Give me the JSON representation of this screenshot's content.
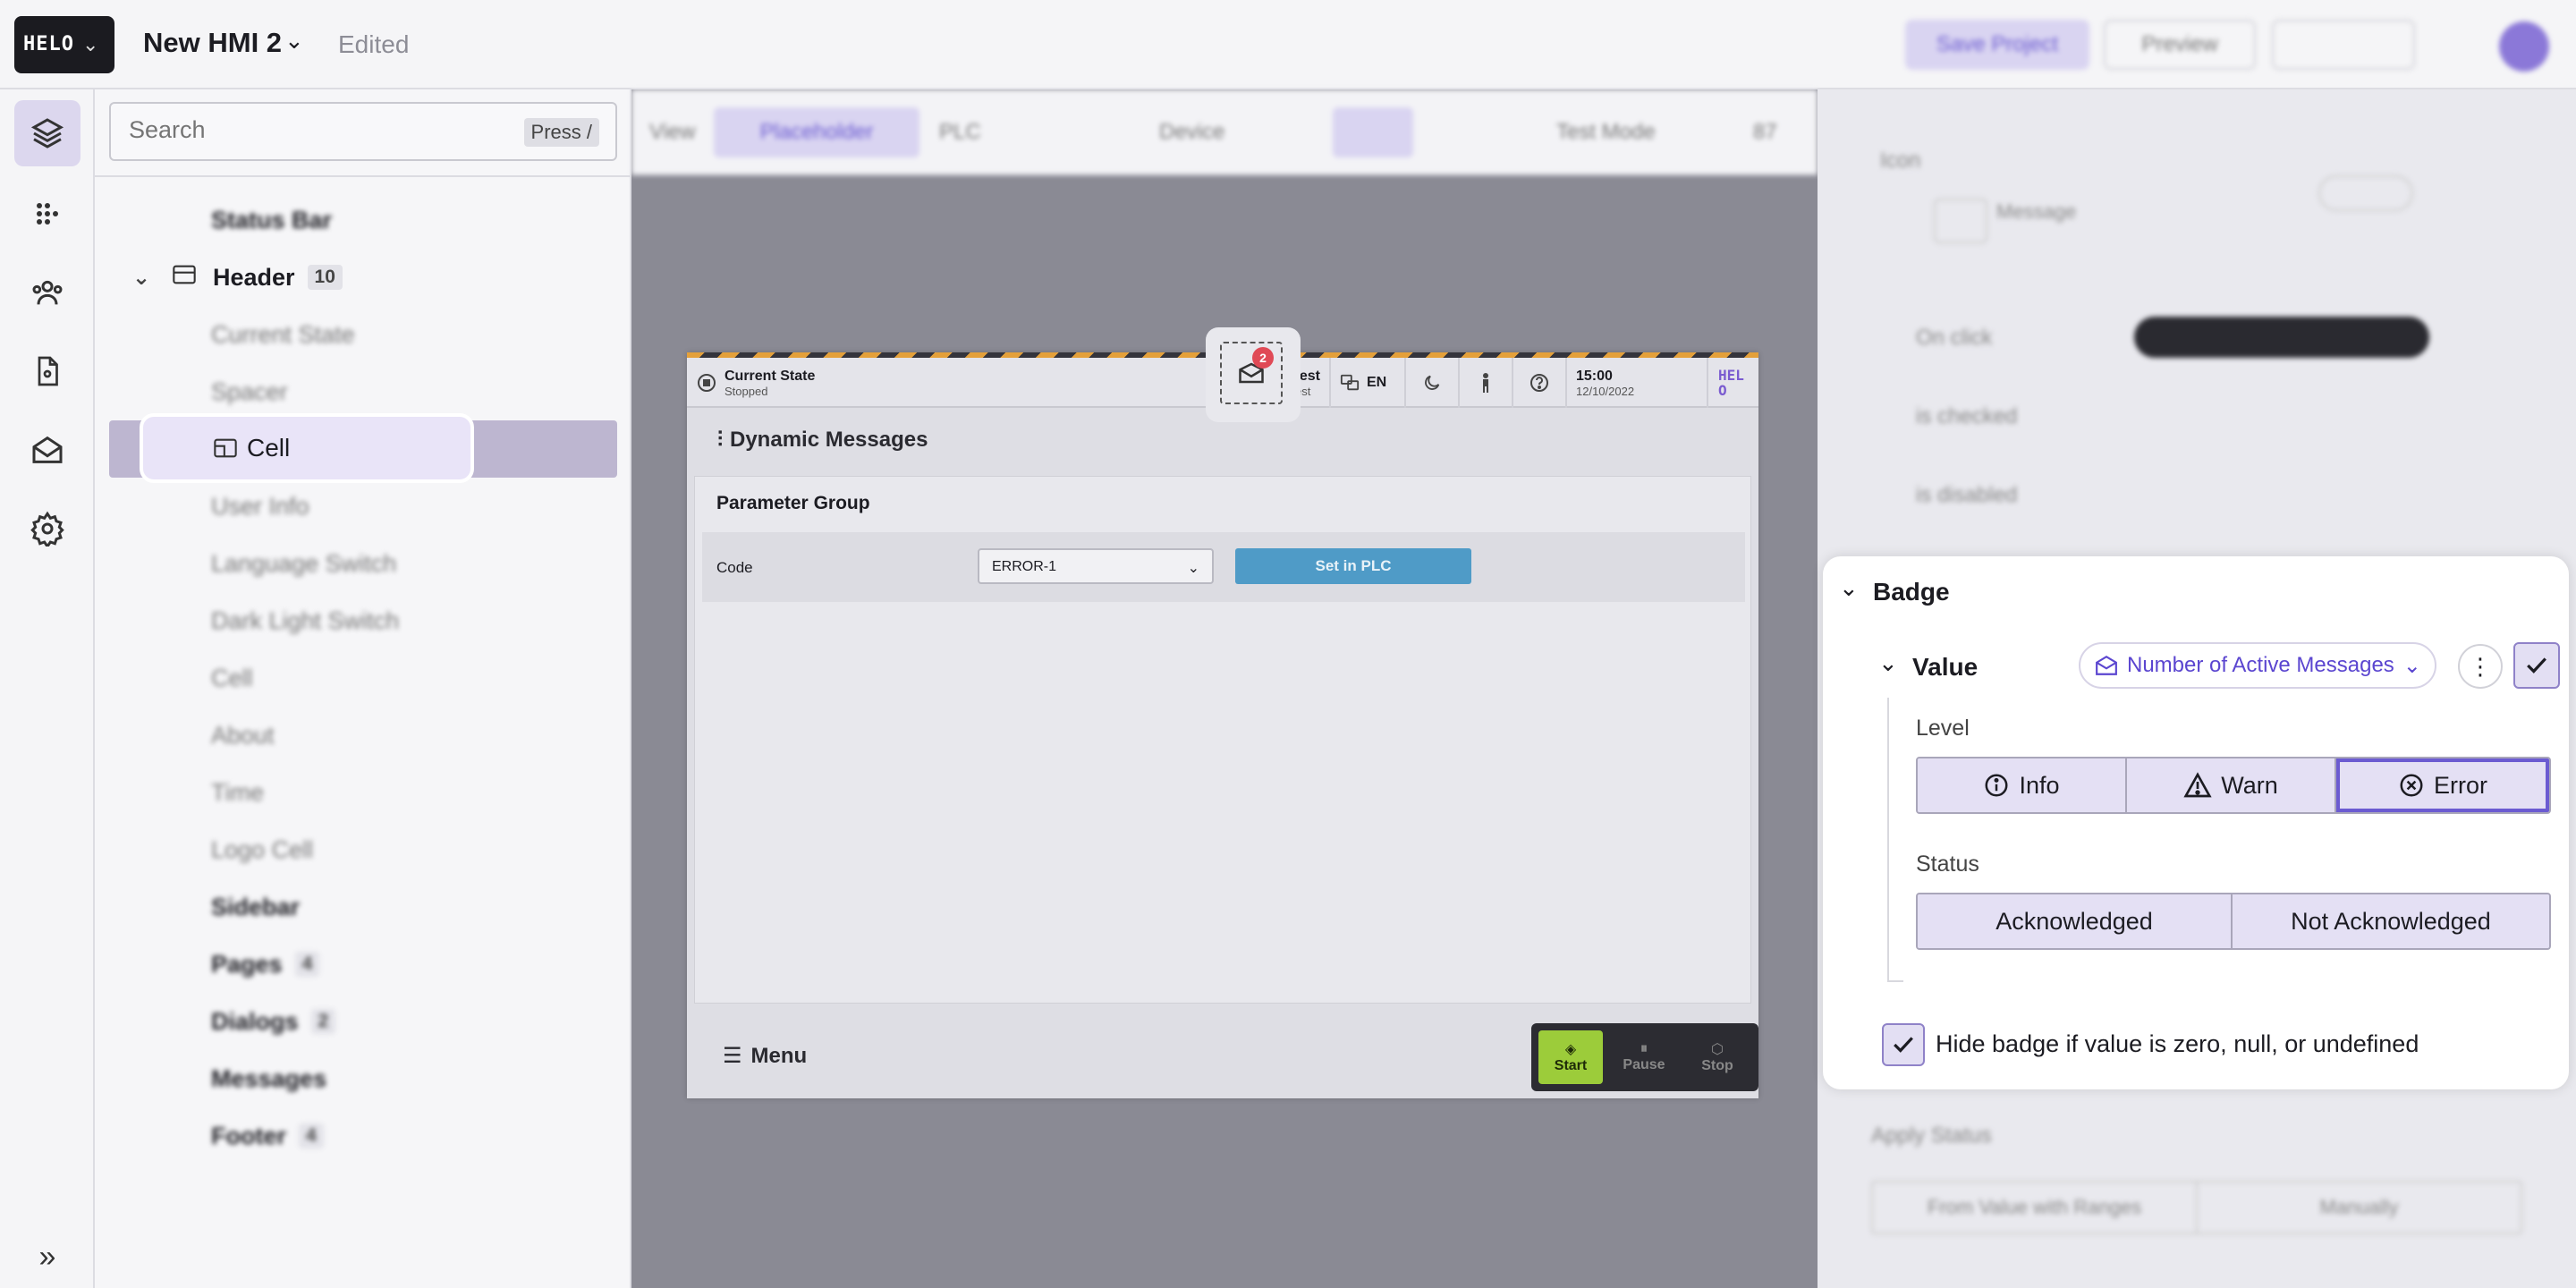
{
  "app": {
    "logo_text": "HELO",
    "project_title": "New HMI 2",
    "status": "Edited"
  },
  "topbar": {
    "save_label": "Save Project",
    "preview_label": "Preview"
  },
  "layers": {
    "search_placeholder": "Search",
    "search_hint": "Press /",
    "items": [
      {
        "label": "Status Bar"
      },
      {
        "label": "Header",
        "count": "10"
      },
      {
        "label": "Current State"
      },
      {
        "label": "Spacer"
      },
      {
        "label": "Cell"
      },
      {
        "label": "User Info"
      },
      {
        "label": "Language Switch"
      },
      {
        "label": "Dark Light Switch"
      },
      {
        "label": "Cell"
      },
      {
        "label": "About"
      },
      {
        "label": "Time"
      },
      {
        "label": "Logo Cell"
      },
      {
        "label": "Sidebar"
      },
      {
        "label": "Pages",
        "count": "4"
      },
      {
        "label": "Dialogs",
        "count": "2"
      },
      {
        "label": "Messages"
      },
      {
        "label": "Footer",
        "count": "4"
      }
    ]
  },
  "canvas_toolbar": {
    "view_label": "View",
    "placeholder_label": "Placeholder",
    "plc_label": "PLC",
    "device_label": "Device",
    "test_mode_label": "Test Mode",
    "zoom_label": "87"
  },
  "hmi": {
    "current_state_label": "Current State",
    "current_state_value": "Stopped",
    "message_count": "2",
    "user_name": "Guest",
    "user_role": "Guest",
    "language": "EN",
    "time": "15:00",
    "date": "12/10/2022",
    "logo_text": "HELO",
    "page_title": "Dynamic Messages",
    "group_title": "Parameter Group",
    "code_label": "Code",
    "code_value": "ERROR-1",
    "set_plc_label": "Set in PLC",
    "menu_label": "Menu",
    "start_label": "Start",
    "pause_label": "Pause",
    "stop_label": "Stop"
  },
  "right_panel": {
    "state_label": "Icon",
    "on_click_label": "On click",
    "is_checked_label": "is checked",
    "is_disabled_label": "is disabled",
    "message_label": "Message",
    "apply_status_label": "Apply Status",
    "from_value_label": "From Value with Ranges",
    "manually_label": "Manually"
  },
  "badge": {
    "section_title": "Badge",
    "value_label": "Value",
    "value_source": "Number of Active Messages",
    "level_label": "Level",
    "level_options": [
      "Info",
      "Warn",
      "Error"
    ],
    "level_selected": "Error",
    "status_label": "Status",
    "status_options": [
      "Acknowledged",
      "Not Acknowledged"
    ],
    "hide_badge_label": "Hide badge if value is zero, null, or undefined",
    "hide_badge_checked": true
  },
  "colors": {
    "accent": "#6b5bd1",
    "selection": "#e4e0f4",
    "badge_red": "#e04a56",
    "plc_blue": "#4f9bc7",
    "start_green": "#9ccc3a"
  }
}
